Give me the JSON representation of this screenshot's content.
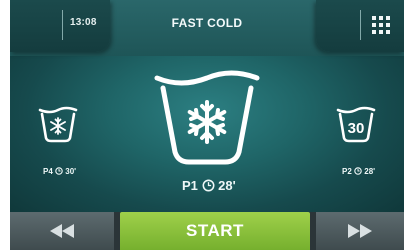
{
  "header": {
    "time": "13:08",
    "title": "FAST COLD",
    "menu_icon": "grid-menu-icon"
  },
  "programs": {
    "left": {
      "label": "P4",
      "duration": "30'",
      "icon": "snowflake-tub-icon"
    },
    "center": {
      "label": "P1",
      "duration": "28'",
      "icon": "snowflake-tub-icon"
    },
    "right": {
      "label": "P2",
      "duration": "28'",
      "icon": "temperature-tub-icon",
      "temperature": "30"
    }
  },
  "footer": {
    "prev_icon": "rewind-icon",
    "start_label": "START",
    "next_icon": "fast-forward-icon"
  },
  "colors": {
    "accent_start": "#8cc63f",
    "screen_bg": "#1f6567",
    "text": "#ffffff"
  }
}
